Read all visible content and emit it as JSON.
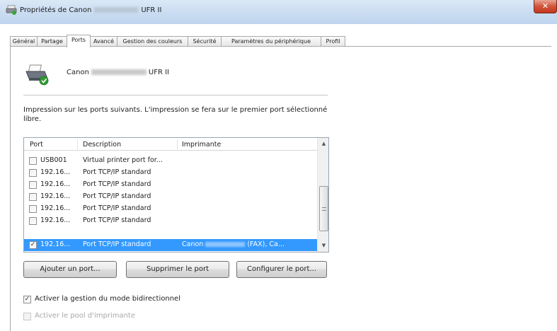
{
  "window": {
    "title_prefix": "Propriétés de Canon",
    "title_suffix": "UFR II",
    "close_label": "✕"
  },
  "tabs": [
    {
      "label": "Général"
    },
    {
      "label": "Partage"
    },
    {
      "label": "Ports",
      "active": true
    },
    {
      "label": "Avancé"
    },
    {
      "label": "Gestion des couleurs"
    },
    {
      "label": "Sécurité"
    },
    {
      "label": "Paramètres du périphérique"
    },
    {
      "label": "Profil"
    }
  ],
  "printer": {
    "name_prefix": "Canon",
    "name_suffix": "UFR II"
  },
  "instructions": "Impression sur les ports suivants. L'impression se fera sur le premier port sélectionné libre.",
  "port_list": {
    "columns": [
      "Port",
      "Description",
      "Imprimante"
    ],
    "rows": [
      {
        "checked": false,
        "port": "USB001",
        "description": "Virtual printer port for...",
        "printer": ""
      },
      {
        "checked": false,
        "port": "192.16...",
        "description": "Port TCP/IP standard",
        "printer": ""
      },
      {
        "checked": false,
        "port": "192.16...",
        "description": "Port TCP/IP standard",
        "printer": ""
      },
      {
        "checked": false,
        "port": "192.16...",
        "description": "Port TCP/IP standard",
        "printer": ""
      },
      {
        "checked": false,
        "port": "192.16...",
        "description": "Port TCP/IP standard",
        "printer": ""
      },
      {
        "checked": false,
        "port": "192.16...",
        "description": "Port TCP/IP standard",
        "printer": ""
      },
      {
        "checked": true,
        "port": "192.16...",
        "description": "Port TCP/IP standard",
        "printer_prefix": "Canon",
        "printer_suffix": "(FAX), Ca...",
        "selected": true
      }
    ],
    "selection_color": "#3399ff"
  },
  "buttons": {
    "add_port": "Ajouter un port...",
    "delete_port": "Supprimer le port",
    "configure_port": "Configurer le port..."
  },
  "options": {
    "bidirectional": {
      "label": "Activer la gestion du mode bidirectionnel",
      "checked": true,
      "enabled": true
    },
    "pooling": {
      "label": "Activer le pool d'imprimante",
      "checked": false,
      "enabled": false
    }
  },
  "icons": {
    "title": "printer-icon",
    "printer": "printer-ok-icon",
    "scroll_up": "chevron-up-icon",
    "scroll_down": "chevron-down-icon"
  }
}
